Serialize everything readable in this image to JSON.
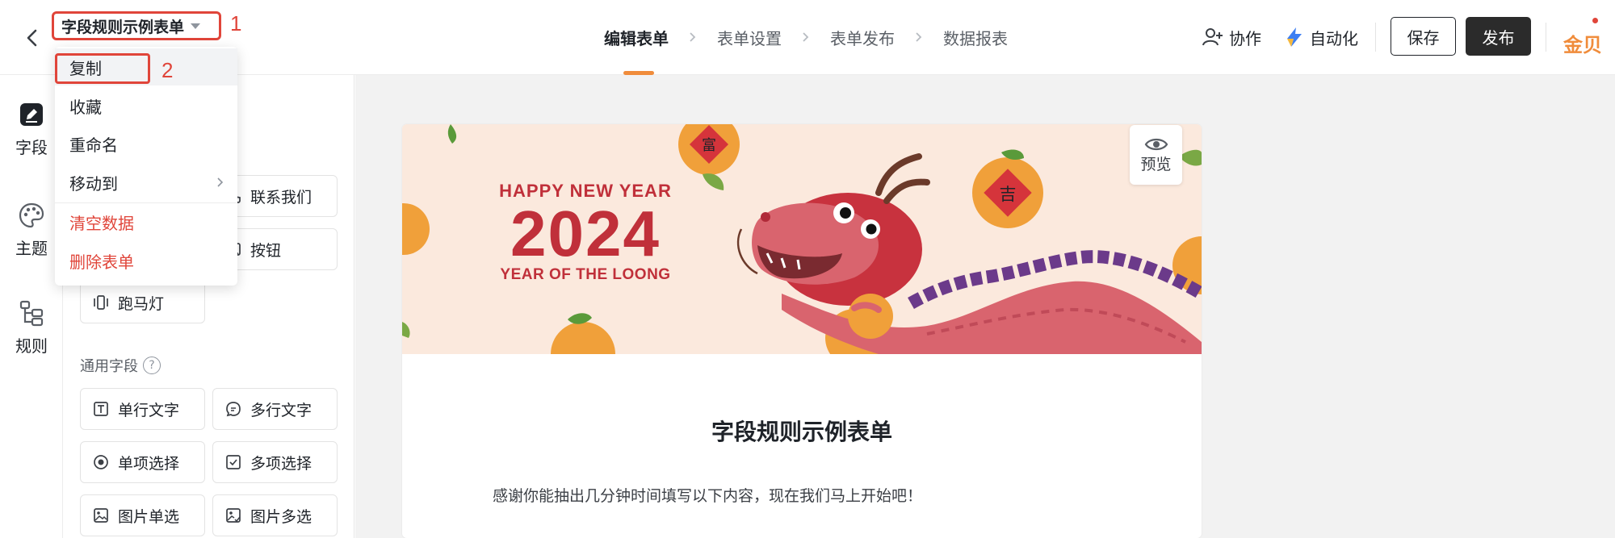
{
  "header": {
    "title": "字段规则示例表单",
    "annotation_1": "1",
    "annotation_2": "2",
    "steps": [
      {
        "label": "编辑表单",
        "active": true
      },
      {
        "label": "表单设置",
        "active": false
      },
      {
        "label": "表单发布",
        "active": false
      },
      {
        "label": "数据报表",
        "active": false
      }
    ],
    "collaborate": "协作",
    "automation": "自动化",
    "save": "保存",
    "publish": "发布",
    "coins": "金贝",
    "accent_color": "#f08c3b",
    "annotation_color": "#e0453a"
  },
  "rail": {
    "items": [
      {
        "label": "字段",
        "icon": "edit-icon"
      },
      {
        "label": "主题",
        "icon": "palette-icon"
      },
      {
        "label": "规则",
        "icon": "rules-icon"
      }
    ]
  },
  "menu": {
    "items": [
      {
        "label": "复制"
      },
      {
        "label": "收藏"
      },
      {
        "label": "重命名"
      },
      {
        "label": "移动到"
      },
      {
        "label": "清空数据"
      },
      {
        "label": "删除表单"
      }
    ]
  },
  "panel": {
    "top_chips": [
      {
        "label": "联系我们",
        "icon": "phone-icon"
      },
      {
        "label": "按钮",
        "icon": "button-icon"
      },
      {
        "label": "跑马灯",
        "icon": "marquee-icon"
      }
    ],
    "common_label": "通用字段",
    "help": "?",
    "common_fields": [
      {
        "label": "单行文字",
        "icon": "text-icon"
      },
      {
        "label": "多行文字",
        "icon": "multiline-icon"
      },
      {
        "label": "单项选择",
        "icon": "radio-icon"
      },
      {
        "label": "多项选择",
        "icon": "checkbox-icon"
      },
      {
        "label": "图片单选",
        "icon": "image-icon"
      },
      {
        "label": "图片多选",
        "icon": "image-multi-icon"
      }
    ]
  },
  "canvas": {
    "preview": "预览",
    "banner": {
      "line1": "HAPPY NEW YEAR",
      "year": "2024",
      "line3": "YEAR OF THE LOONG",
      "badge1": "富",
      "badge2": "吉"
    },
    "form_title": "字段规则示例表单",
    "form_desc": "感谢你能抽出几分钟时间填写以下内容，现在我们马上开始吧！"
  }
}
